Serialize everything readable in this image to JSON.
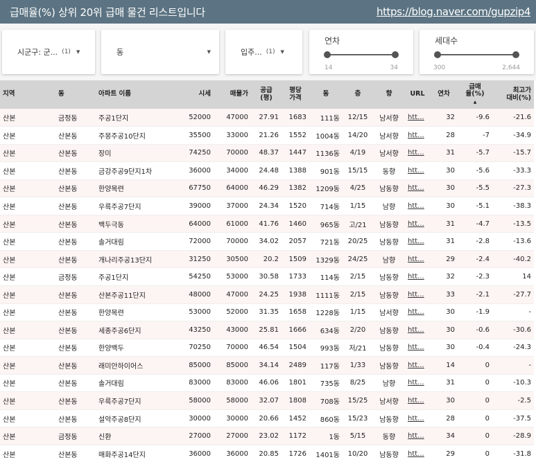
{
  "header": {
    "title": "급매율(%) 상위 20위 급매 물건 리스트입니다",
    "link": "https://blog.naver.com/gupzip4"
  },
  "filters": {
    "district": {
      "value": "시군구: 군...",
      "count": "(1)"
    },
    "dong": {
      "value": "동"
    },
    "move_in": {
      "value": "입주...",
      "count": "(1)"
    },
    "age": {
      "label": "연차",
      "min": "14",
      "max": "34",
      "low": 0.0,
      "high": 1.0
    },
    "households": {
      "label": "세대수",
      "min": "300",
      "max": "2,644",
      "low": 0.0,
      "high": 1.0
    }
  },
  "table": {
    "columns": [
      "지역",
      "동",
      "아파트 이름",
      "시세",
      "매물가",
      "공급\n(평)",
      "평당\n가격",
      "동",
      "층",
      "향",
      "URL",
      "연차",
      "급매\n율(%)",
      "최고가\n대비(%)"
    ],
    "rows": [
      [
        "산본",
        "금정동",
        "주공1단지",
        "52000",
        "47000",
        "27.91",
        "1683",
        "111동",
        "12/15",
        "남서향",
        "htt...",
        "32",
        "-9.6",
        "-21.6"
      ],
      [
        "산본",
        "산본동",
        "주몽주공10단지",
        "35500",
        "33000",
        "21.26",
        "1552",
        "1004동",
        "14/20",
        "남서향",
        "htt...",
        "28",
        "-7",
        "-34.9"
      ],
      [
        "산본",
        "산본동",
        "장미",
        "74250",
        "70000",
        "48.37",
        "1447",
        "1136동",
        "4/19",
        "남서향",
        "htt...",
        "31",
        "-5.7",
        "-15.7"
      ],
      [
        "산본",
        "산본동",
        "금강주공9단지1차",
        "36000",
        "34000",
        "24.48",
        "1388",
        "901동",
        "15/15",
        "동향",
        "htt...",
        "30",
        "-5.6",
        "-33.3"
      ],
      [
        "산본",
        "산본동",
        "한양목련",
        "67750",
        "64000",
        "46.29",
        "1382",
        "1209동",
        "4/25",
        "남동향",
        "htt...",
        "30",
        "-5.5",
        "-27.3"
      ],
      [
        "산본",
        "산본동",
        "우륵주공7단지",
        "39000",
        "37000",
        "24.34",
        "1520",
        "714동",
        "1/15",
        "남향",
        "htt...",
        "30",
        "-5.1",
        "-38.3"
      ],
      [
        "산본",
        "산본동",
        "백두극동",
        "64000",
        "61000",
        "41.76",
        "1460",
        "965동",
        "고/21",
        "남동향",
        "htt...",
        "31",
        "-4.7",
        "-13.5"
      ],
      [
        "산본",
        "산본동",
        "솔거대림",
        "72000",
        "70000",
        "34.02",
        "2057",
        "721동",
        "20/25",
        "남동향",
        "htt...",
        "31",
        "-2.8",
        "-13.6"
      ],
      [
        "산본",
        "산본동",
        "개나리주공13단지",
        "31250",
        "30500",
        "20.2",
        "1509",
        "1329동",
        "24/25",
        "남향",
        "htt...",
        "29",
        "-2.4",
        "-40.2"
      ],
      [
        "산본",
        "금정동",
        "주공1단지",
        "54250",
        "53000",
        "30.58",
        "1733",
        "114동",
        "2/15",
        "남동향",
        "htt...",
        "32",
        "-2.3",
        "14"
      ],
      [
        "산본",
        "산본동",
        "산본주공11단지",
        "48000",
        "47000",
        "24.25",
        "1938",
        "1111동",
        "2/15",
        "남동향",
        "htt...",
        "33",
        "-2.1",
        "-27.7"
      ],
      [
        "산본",
        "산본동",
        "한양목련",
        "53000",
        "52000",
        "31.35",
        "1658",
        "1228동",
        "1/15",
        "남서향",
        "htt...",
        "30",
        "-1.9",
        "-"
      ],
      [
        "산본",
        "산본동",
        "세종주공6단지",
        "43250",
        "43000",
        "25.81",
        "1666",
        "634동",
        "2/20",
        "남동향",
        "htt...",
        "30",
        "-0.6",
        "-30.6"
      ],
      [
        "산본",
        "산본동",
        "한양백두",
        "70250",
        "70000",
        "46.54",
        "1504",
        "993동",
        "저/21",
        "남동향",
        "htt...",
        "30",
        "-0.4",
        "-24.3"
      ],
      [
        "산본",
        "산본동",
        "래미안하이어스",
        "85000",
        "85000",
        "34.14",
        "2489",
        "117동",
        "1/33",
        "남동향",
        "htt...",
        "14",
        "0",
        "-"
      ],
      [
        "산본",
        "산본동",
        "솔거대림",
        "83000",
        "83000",
        "46.06",
        "1801",
        "735동",
        "8/25",
        "남향",
        "htt...",
        "31",
        "0",
        "-10.3"
      ],
      [
        "산본",
        "산본동",
        "우륵주공7단지",
        "58000",
        "58000",
        "32.07",
        "1808",
        "708동",
        "15/25",
        "남서향",
        "htt...",
        "30",
        "0",
        "-2.5"
      ],
      [
        "산본",
        "산본동",
        "설악주공8단지",
        "30000",
        "30000",
        "20.66",
        "1452",
        "860동",
        "15/23",
        "남동향",
        "htt...",
        "28",
        "0",
        "-37.5"
      ],
      [
        "산본",
        "금정동",
        "신환",
        "27000",
        "27000",
        "23.02",
        "1172",
        "1동",
        "5/15",
        "동향",
        "htt...",
        "34",
        "0",
        "-28.9"
      ],
      [
        "산본",
        "산본동",
        "매화주공14단지",
        "36000",
        "36000",
        "20.85",
        "1726",
        "1401동",
        "10/20",
        "남동향",
        "htt...",
        "29",
        "0",
        "-31.8"
      ]
    ]
  },
  "icons": {
    "dropdown": "chevron-down-icon",
    "sort": "sort-desc-icon"
  },
  "colors": {
    "header_bg": "#5b7382",
    "table_header_bg": "#d4d4d4",
    "row_alt_bg": "#fdf5f3"
  }
}
